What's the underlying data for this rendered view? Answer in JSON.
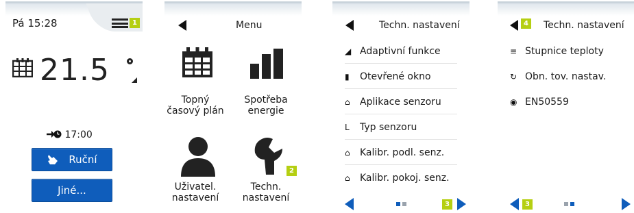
{
  "colors": {
    "accent": "#0f5dbb",
    "badge": "#b5cf12",
    "text": "#1a1a1a"
  },
  "screen_home": {
    "clock": "Pá 15:28",
    "menu_badge": "1",
    "temperature": "21.5",
    "next_time": "17:00",
    "manual_button": "Ruční",
    "other_button": "Jiné..."
  },
  "screen_menu": {
    "title": "Menu",
    "items": [
      {
        "label": "Topný časový plán",
        "icon": "calendar-icon"
      },
      {
        "label": "Spotřeba energie",
        "icon": "bar-chart-icon"
      },
      {
        "label": "Uživatel. nastavení",
        "icon": "user-icon"
      },
      {
        "label": "Techn. nastavení",
        "icon": "wrench-icon"
      }
    ],
    "tech_badge": "2"
  },
  "screen_tech1": {
    "title": "Techn. nastavení",
    "items": [
      {
        "label": "Adaptivní funkce",
        "icon": "adaptive-icon"
      },
      {
        "label": "Otevřené okno",
        "icon": "window-icon"
      },
      {
        "label": "Aplikace senzoru",
        "icon": "house-icon"
      },
      {
        "label": "Typ senzoru",
        "icon": "sensor-type-icon"
      },
      {
        "label": "Kalibr. podl. senz.",
        "icon": "house-icon"
      },
      {
        "label": "Kalibr. pokoj. senz.",
        "icon": "house-icon"
      }
    ],
    "next_badge": "3"
  },
  "screen_tech2": {
    "title": "Techn. nastavení",
    "back_badge": "4",
    "items": [
      {
        "label": "Stupnice teploty",
        "icon": "scale-icon"
      },
      {
        "label": "Obn. tov. nastav.",
        "icon": "reset-icon"
      },
      {
        "label": "EN50559",
        "icon": "globe-icon"
      }
    ],
    "prev_badge": "3"
  }
}
